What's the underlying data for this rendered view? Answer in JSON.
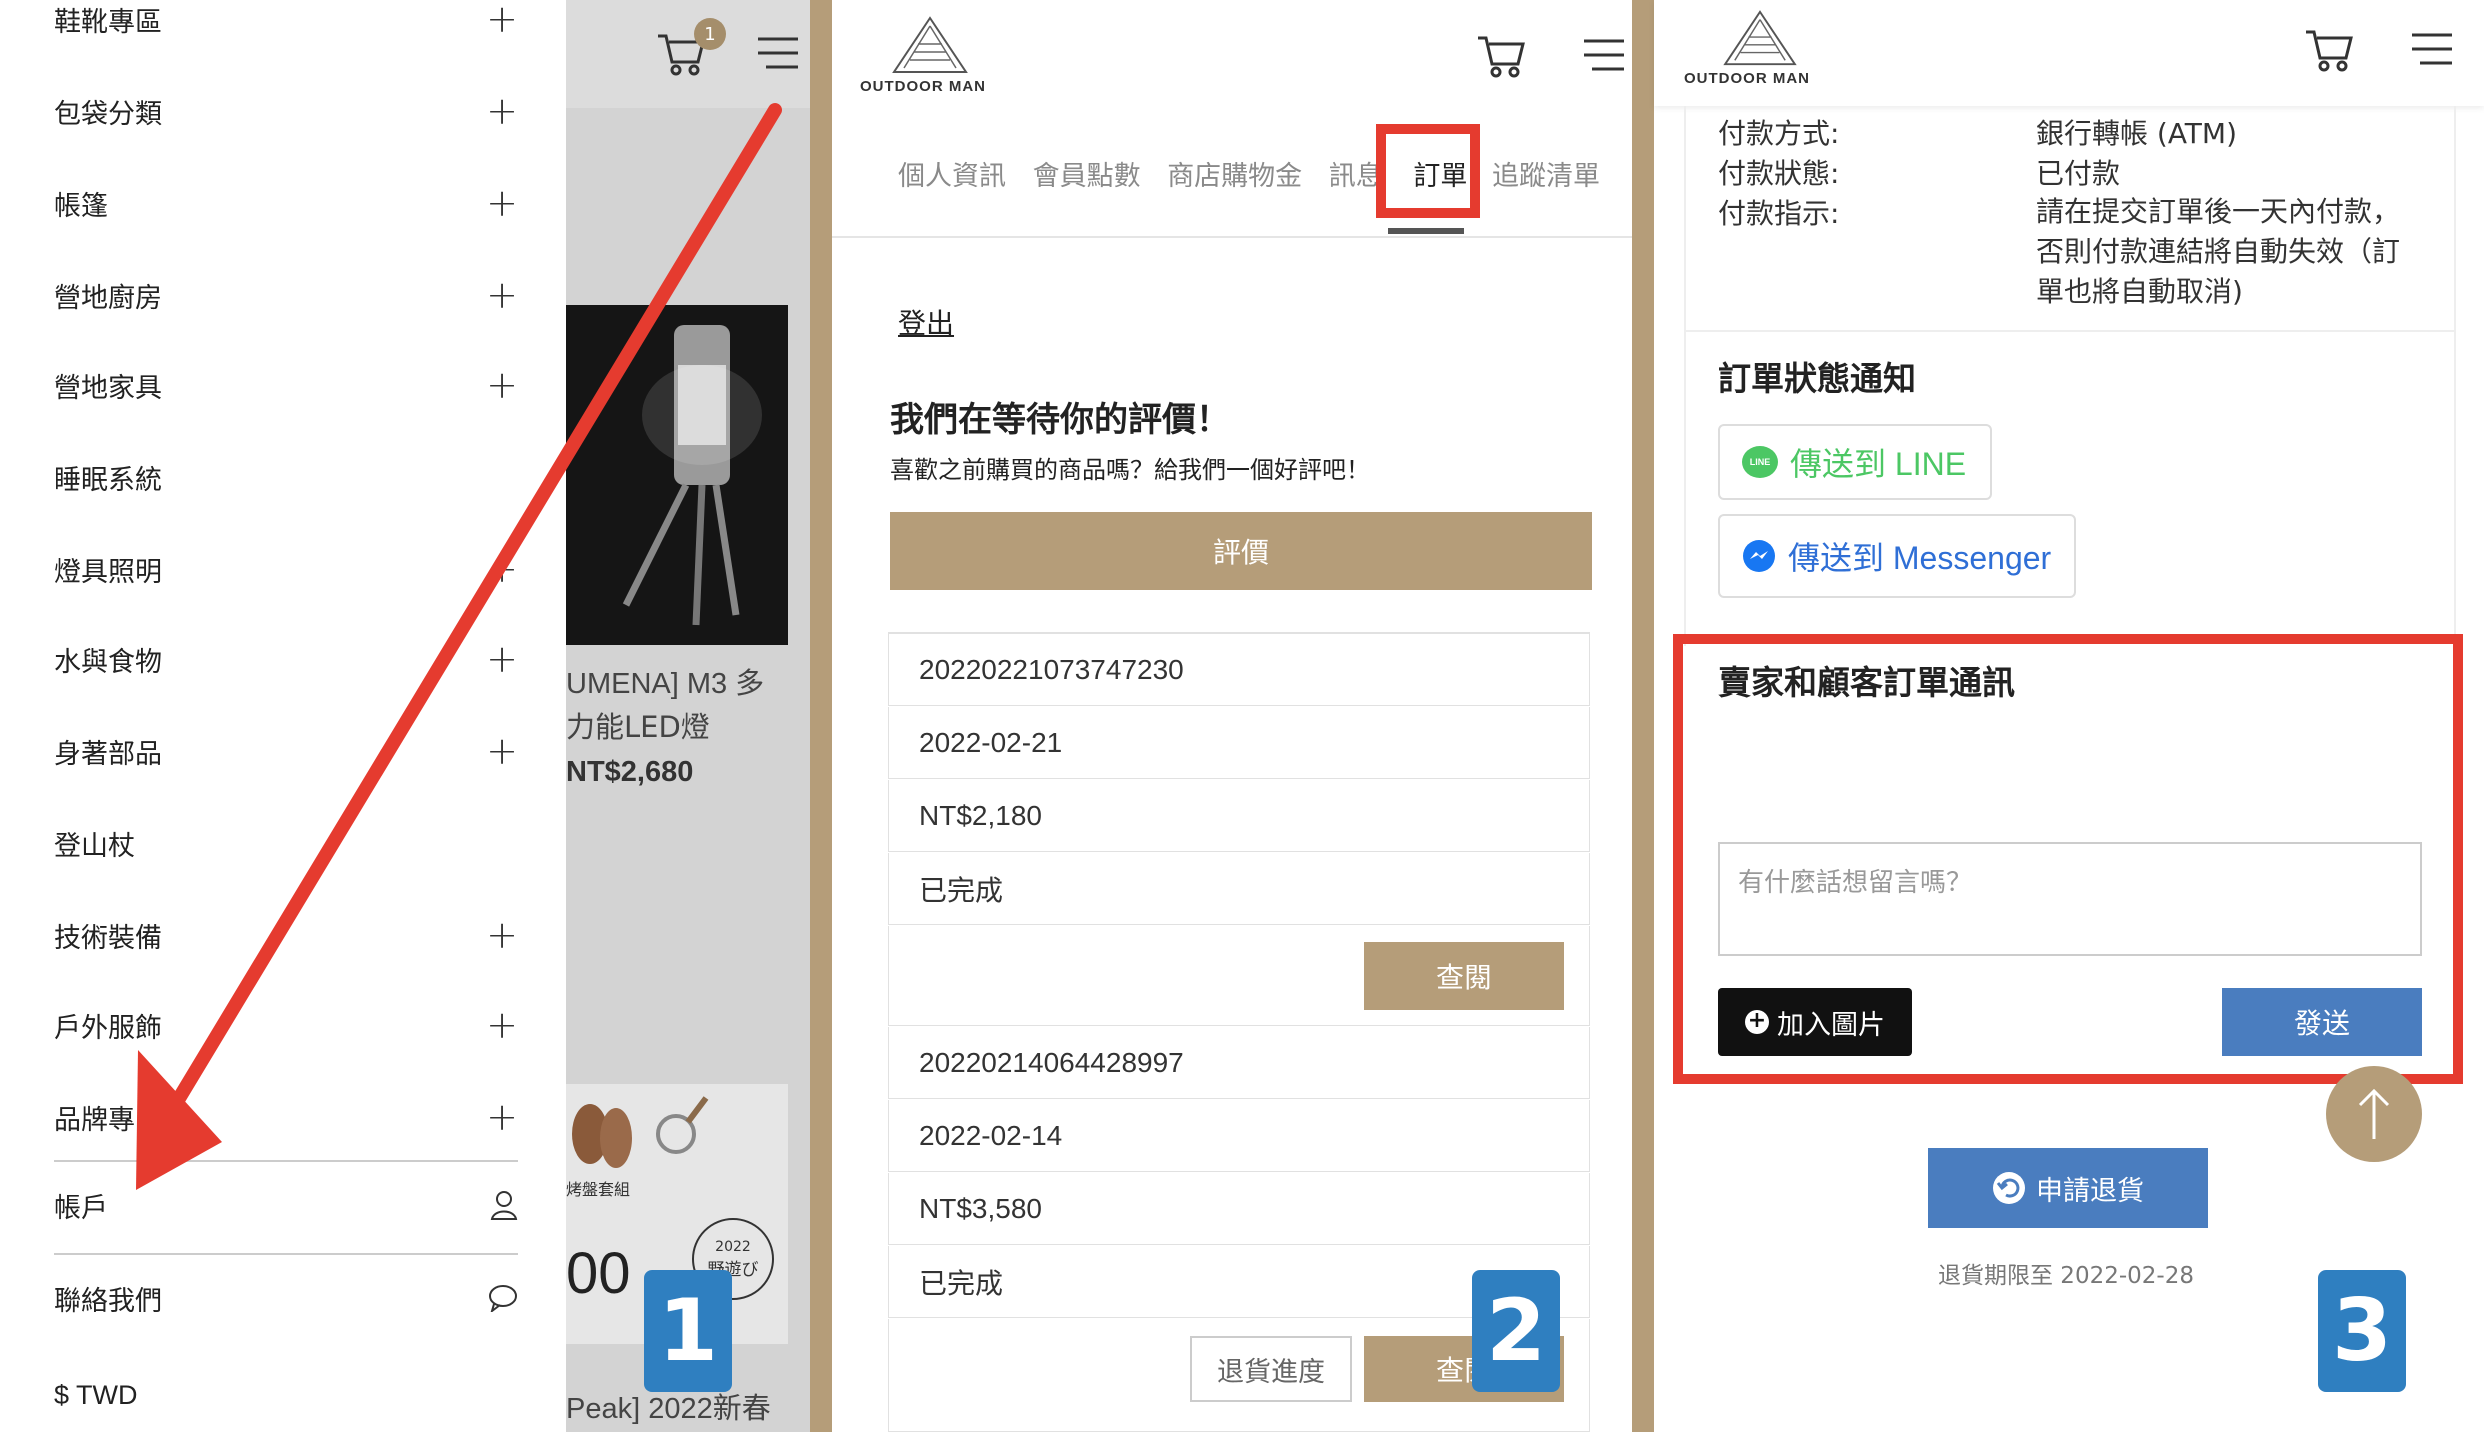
{
  "panel1": {
    "menu_items": [
      {
        "label": "鞋靴專區",
        "plus": true
      },
      {
        "label": "包袋分類",
        "plus": true
      },
      {
        "label": "帳篷",
        "plus": true
      },
      {
        "label": "營地廚房",
        "plus": true
      },
      {
        "label": "營地家具",
        "plus": true
      },
      {
        "label": "睡眠系統",
        "plus": false
      },
      {
        "label": "燈具照明",
        "plus": true
      },
      {
        "label": "水與食物",
        "plus": true
      },
      {
        "label": "身著部品",
        "plus": true
      },
      {
        "label": "登山杖",
        "plus": false
      },
      {
        "label": "技術裝備",
        "plus": true
      },
      {
        "label": "戶外服飾",
        "plus": true
      },
      {
        "label": "品牌專區",
        "plus": true
      }
    ],
    "account_label": "帳戶",
    "contact_label": "聯絡我們",
    "currency_label": "$ TWD",
    "cart_count": "1",
    "product_name_line1": "UMENA] M3 多",
    "product_name_line2": "力能LED燈",
    "product_price": "NT$2,680",
    "promo_small1": "烤盤套組",
    "promo_small2": "2022",
    "promo_small3": "野遊び",
    "promo_price": "00",
    "product2_name": "Peak] 2022新春",
    "step_number": "1"
  },
  "panel2": {
    "brand": "OUTDOOR MAN",
    "tabs": [
      "個人資訊",
      "會員點數",
      "商店購物金",
      "訊息",
      "訂單",
      "追蹤清單"
    ],
    "active_tab": "訂單",
    "logout": "登出",
    "review_title": "我們在等待你的評價！",
    "review_sub": "喜歡之前購買的商品嗎？給我們一個好評吧！",
    "review_button": "評價",
    "orders": [
      {
        "number": "20220221073747230",
        "date": "2022-02-21",
        "total": "NT$2,180",
        "status": "已完成",
        "view": "查閱"
      },
      {
        "number": "20220214064428997",
        "date": "2022-02-14",
        "total": "NT$3,580",
        "status": "已完成",
        "view": "查閱",
        "return_progress": "退貨進度"
      }
    ],
    "step_number": "2"
  },
  "panel3": {
    "brand": "OUTDOOR MAN",
    "payment": [
      {
        "k": "付款方式:",
        "v": "銀行轉帳 (ATM)"
      },
      {
        "k": "付款狀態:",
        "v": "已付款"
      },
      {
        "k": "付款指示:",
        "v": "請在提交訂單後一天內付款，否則付款連結將自動失效（訂單也將自動取消)"
      }
    ],
    "payment_instr_lines": [
      "請在提交訂單後一天內付款，",
      "否則付款連結將自動失效（訂",
      "單也將自動取消)"
    ],
    "notify_title": "訂單狀態通知",
    "line_button": "傳送到 LINE",
    "messenger_button": "傳送到 Messenger",
    "chat_title": "賣家和顧客訂單通訊",
    "chat_placeholder": "有什麼話想留言嗎？",
    "add_image": "加入圖片",
    "send": "發送",
    "return_button": "申請退貨",
    "return_deadline": "退貨期限至 2022-02-28",
    "step_number": "3",
    "line_icon_text": "LINE"
  },
  "colors": {
    "tan": "#b59d79",
    "red": "#e53b2f",
    "blue": "#2f7fc0",
    "line_green": "#4cc764",
    "messenger_blue": "#1877f2",
    "send_blue": "#4a7dbf"
  }
}
